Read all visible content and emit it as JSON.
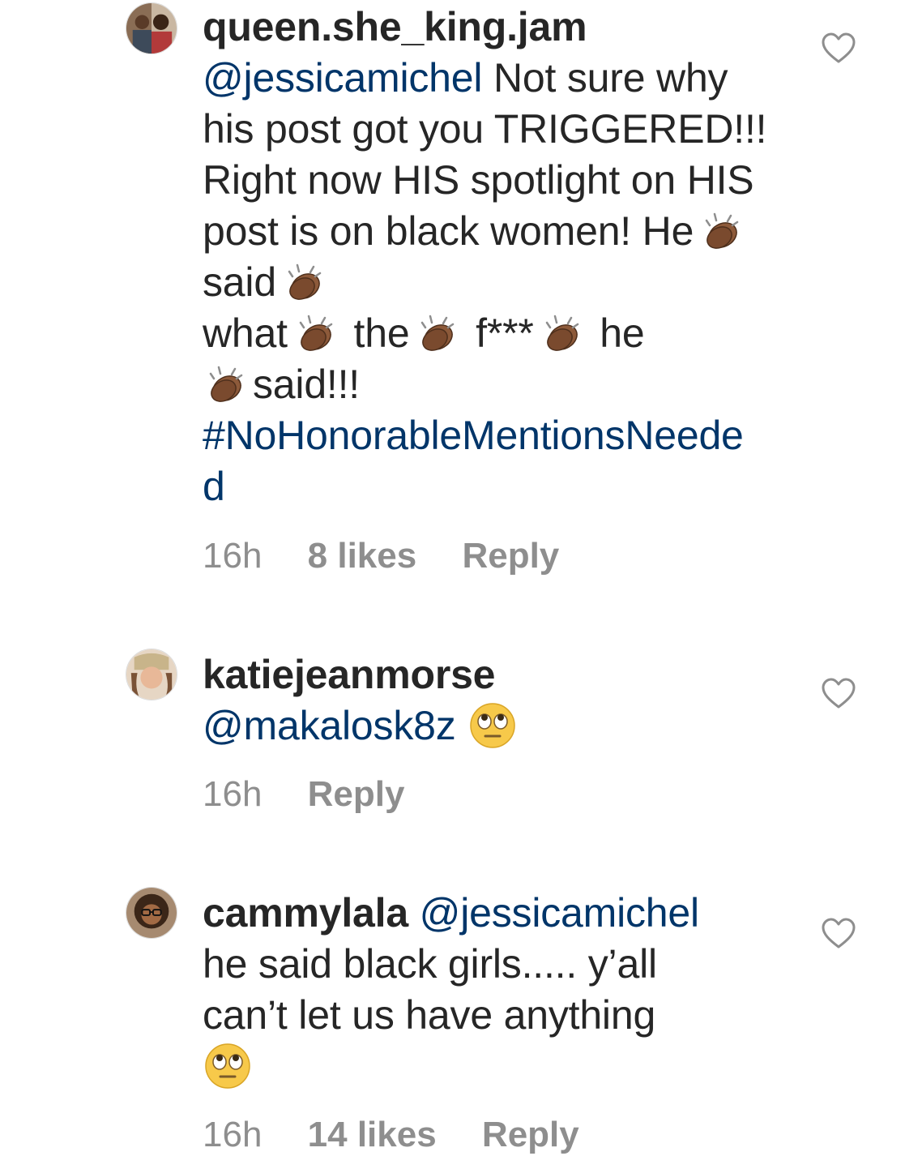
{
  "comments": [
    {
      "username": "queen.she_king.jam",
      "mention": "@jessicamichel",
      "text_1": " Not sure why his post got you TRIGGERED!!! Right now HIS spotlight on HIS post is on black women! He",
      "text_2": " said",
      "text_3": " what",
      "text_4": " the",
      "text_5": " f***",
      "text_6": " he",
      "text_7": "said!!!",
      "hashtag": "#NoHonorableMentionsNeeded",
      "time": "16h",
      "likes": "8 likes",
      "reply": "Reply",
      "emoji": "clapping-hands-icon"
    },
    {
      "username": "katiejeanmorse",
      "mention": "@makalosk8z",
      "time": "16h",
      "reply": "Reply",
      "emoji": "face-with-rolling-eyes-icon"
    },
    {
      "username": "cammylala",
      "mention": "@jessicamichel",
      "text_1": "he said black girls..... y’all can’t let us have anything",
      "time": "16h",
      "likes": "14 likes",
      "reply": "Reply",
      "emoji": "face-with-rolling-eyes-icon"
    }
  ],
  "colors": {
    "text": "#262626",
    "link": "#003569",
    "meta": "#8e8e8e",
    "heart": "#8e8e8e"
  }
}
